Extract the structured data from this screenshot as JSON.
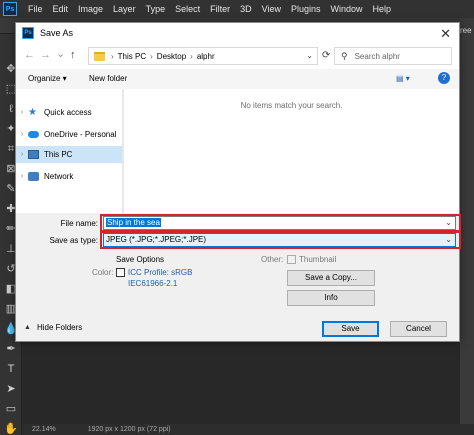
{
  "ps": {
    "logo": "Ps",
    "menu": [
      "File",
      "Edit",
      "Image",
      "Layer",
      "Type",
      "Select",
      "Filter",
      "3D",
      "View",
      "Plugins",
      "Window",
      "Help"
    ],
    "right_text": "ree",
    "status_zoom": "22.14%",
    "status_doc": "1920 px x 1200 px (72 ppi)"
  },
  "dialog": {
    "icon": "Ps",
    "title": "Save As",
    "close": "✕",
    "nav_back": "←",
    "nav_forward": "→",
    "nav_recent": "⌄",
    "nav_up": "↑",
    "breadcrumb": [
      "This PC",
      "Desktop",
      "alphr"
    ],
    "breadcrumb_sep": "›",
    "search_placeholder": "Search alphr",
    "organize_label": "Organize ▾",
    "new_folder_label": "New folder",
    "view_label": "▤ ▾",
    "help": "?",
    "nav_items": [
      "Quick access",
      "OneDrive - Personal",
      "This PC",
      "Network"
    ],
    "empty_message": "No items match your search.",
    "file_name_label": "File name:",
    "file_name_value": "Ship in the sea",
    "save_type_label": "Save as type:",
    "save_type_value": "JPEG (*.JPG;*.JPEG;*.JPE)",
    "save_options_label": "Save Options",
    "color_label": "Color:",
    "icc_line1": "ICC Profile:  sRGB",
    "icc_line2": "IEC61966-2.1",
    "other_label": "Other:",
    "thumbnail_label": "Thumbnail",
    "save_copy_label": "Save a Copy...",
    "info_label": "Info",
    "save_label": "Save",
    "cancel_label": "Cancel",
    "hide_folders_label": "Hide Folders"
  },
  "colors": {
    "highlight": "#d8232a",
    "selection": "#0078d7",
    "ps_accent": "#31a8ff"
  }
}
